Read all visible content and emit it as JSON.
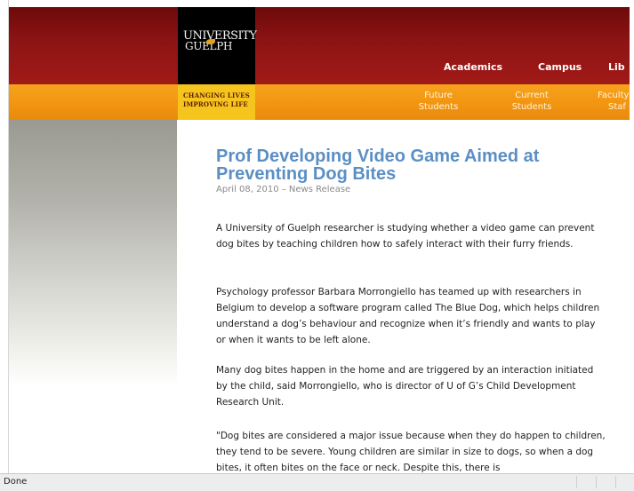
{
  "header": {
    "logo_line1": "UNIVERSITY",
    "logo_line2": "GUELPH",
    "nav": [
      "Academics",
      "Campus",
      "Lib"
    ]
  },
  "tagline": {
    "line1": "Changing Lives",
    "line2": "Improving Life"
  },
  "subnav": [
    {
      "line1": "Future",
      "line2": "Students"
    },
    {
      "line1": "Current",
      "line2": "Students"
    },
    {
      "line1": "Faculty",
      "line2": "Staf"
    }
  ],
  "article": {
    "title": "Prof Developing Video Game Aimed at Preventing Dog Bites",
    "date": "April 08, 2010 – News Release",
    "paragraphs": [
      "A University of Guelph researcher is studying whether a video game can prevent dog bites by teaching children how to safely interact with their furry friends.",
      "Psychology professor Barbara Morrongiello has teamed up with researchers in Belgium to develop a software program called The Blue Dog, which helps children understand a dog’s behaviour and recognize when it’s friendly and wants to play or when it wants to be left alone.",
      "Many dog bites happen in the home and are triggered by an interaction initiated by the child, said Morrongiello, who is director of U of G’s Child Development Research Unit.",
      "\"Dog bites are considered a major issue because when they do happen to children, they tend to be severe. Young children are similar in size to dogs, so when a dog bites, it often bites on the face or neck. Despite this, there is"
    ]
  },
  "status": {
    "text": "Done"
  },
  "colors": {
    "header_red": "#8d1414",
    "orange_bar": "#f29410",
    "title_blue": "#5b8fc4"
  }
}
